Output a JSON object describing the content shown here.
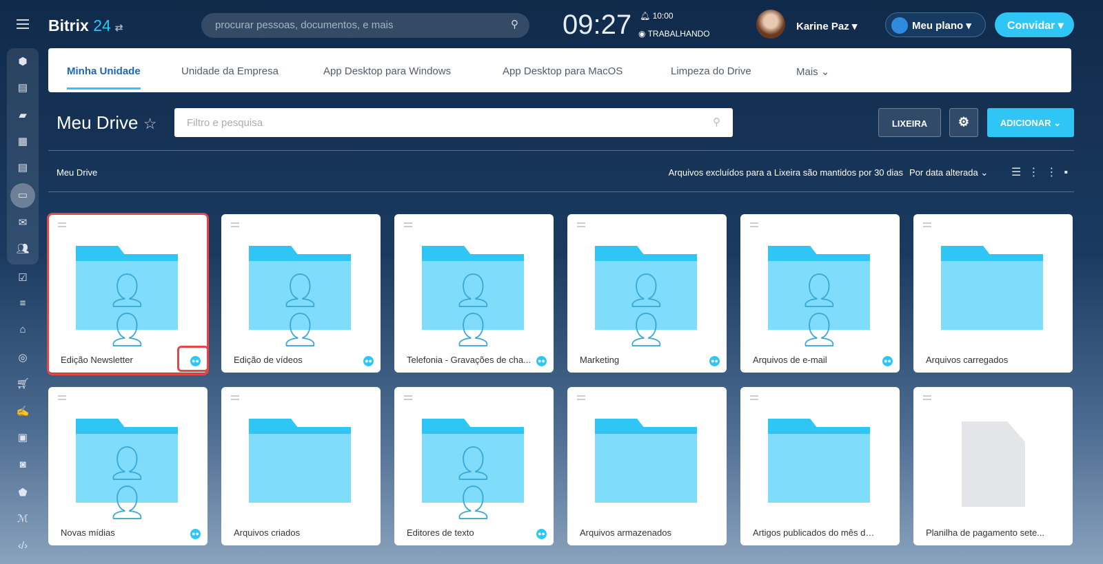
{
  "header": {
    "logo_main": "Bitrix",
    "logo_num": "24",
    "search_placeholder": "procurar pessoas, documentos, e mais",
    "clock": "09:27",
    "alarm": "10:00",
    "status": "TRABALHANDO",
    "user": "Karine Paz",
    "plan": "Meu plano",
    "invite": "Convidar"
  },
  "tabs": [
    "Minha Unidade",
    "Unidade da Empresa",
    "App Desktop para Windows",
    "App Desktop para MacOS",
    "Limpeza do Drive",
    "Mais"
  ],
  "page": {
    "title": "Meu Drive",
    "filter_placeholder": "Filtro e pesquisa",
    "trash": "LIXEIRA",
    "add": "ADICIONAR",
    "breadcrumb": "Meu Drive",
    "note": "Arquivos excluídos para a Lixeira são mantidos por 30 dias",
    "sort": "Por data alterada"
  },
  "items": [
    {
      "name": "Edição Newsletter",
      "type": "shared-folder"
    },
    {
      "name": "Edição de vídeos",
      "type": "shared-folder"
    },
    {
      "name": "Telefonia - Gravações de cha...",
      "type": "shared-folder"
    },
    {
      "name": "Marketing",
      "type": "shared-folder"
    },
    {
      "name": "Arquivos de e-mail",
      "type": "shared-folder"
    },
    {
      "name": "Arquivos carregados",
      "type": "folder"
    },
    {
      "name": "Novas mídias",
      "type": "shared-folder"
    },
    {
      "name": "Arquivos criados",
      "type": "folder"
    },
    {
      "name": "Editores de texto",
      "type": "shared-folder"
    },
    {
      "name": "Arquivos armazenados",
      "type": "folder"
    },
    {
      "name": "Artigos publicados do mês de m...",
      "type": "folder"
    },
    {
      "name": "Planilha de pagamento sete...",
      "type": "file"
    }
  ]
}
